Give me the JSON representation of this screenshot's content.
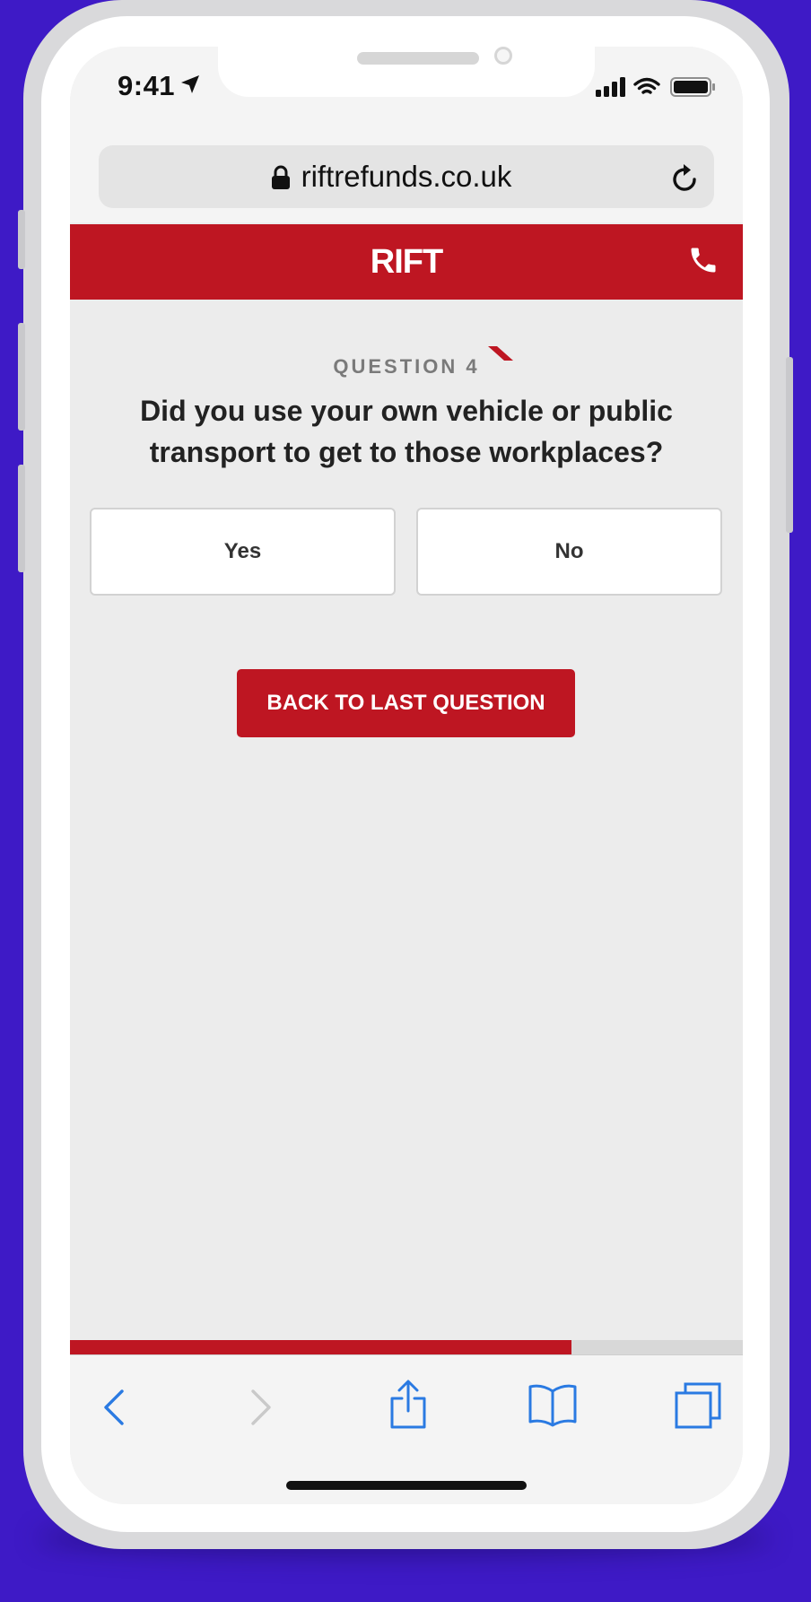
{
  "colors": {
    "background": "#3e1ac6",
    "brand_red": "#be1622",
    "ios_blue": "#2a7ae2",
    "page_bg": "#ececec"
  },
  "status_bar": {
    "time": "9:41",
    "icons": [
      "location-arrow-icon",
      "signal-icon",
      "wifi-icon",
      "battery-icon"
    ]
  },
  "browser": {
    "url": "riftrefunds.co.uk",
    "icons": [
      "lock-icon",
      "reload-icon"
    ]
  },
  "header": {
    "logo_text": "RIFT",
    "phone_icon": "phone-icon"
  },
  "question": {
    "label": "QUESTION 4",
    "text": "Did you use your own vehicle or public transport to get to those workplaces?",
    "options": [
      "Yes",
      "No"
    ]
  },
  "actions": {
    "back_label": "BACK TO LAST QUESTION"
  },
  "progress": {
    "fraction": 0.745
  },
  "toolbar": {
    "icons": [
      "back-arrow-icon",
      "forward-arrow-icon",
      "share-icon",
      "bookmarks-icon",
      "tabs-icon"
    ]
  }
}
